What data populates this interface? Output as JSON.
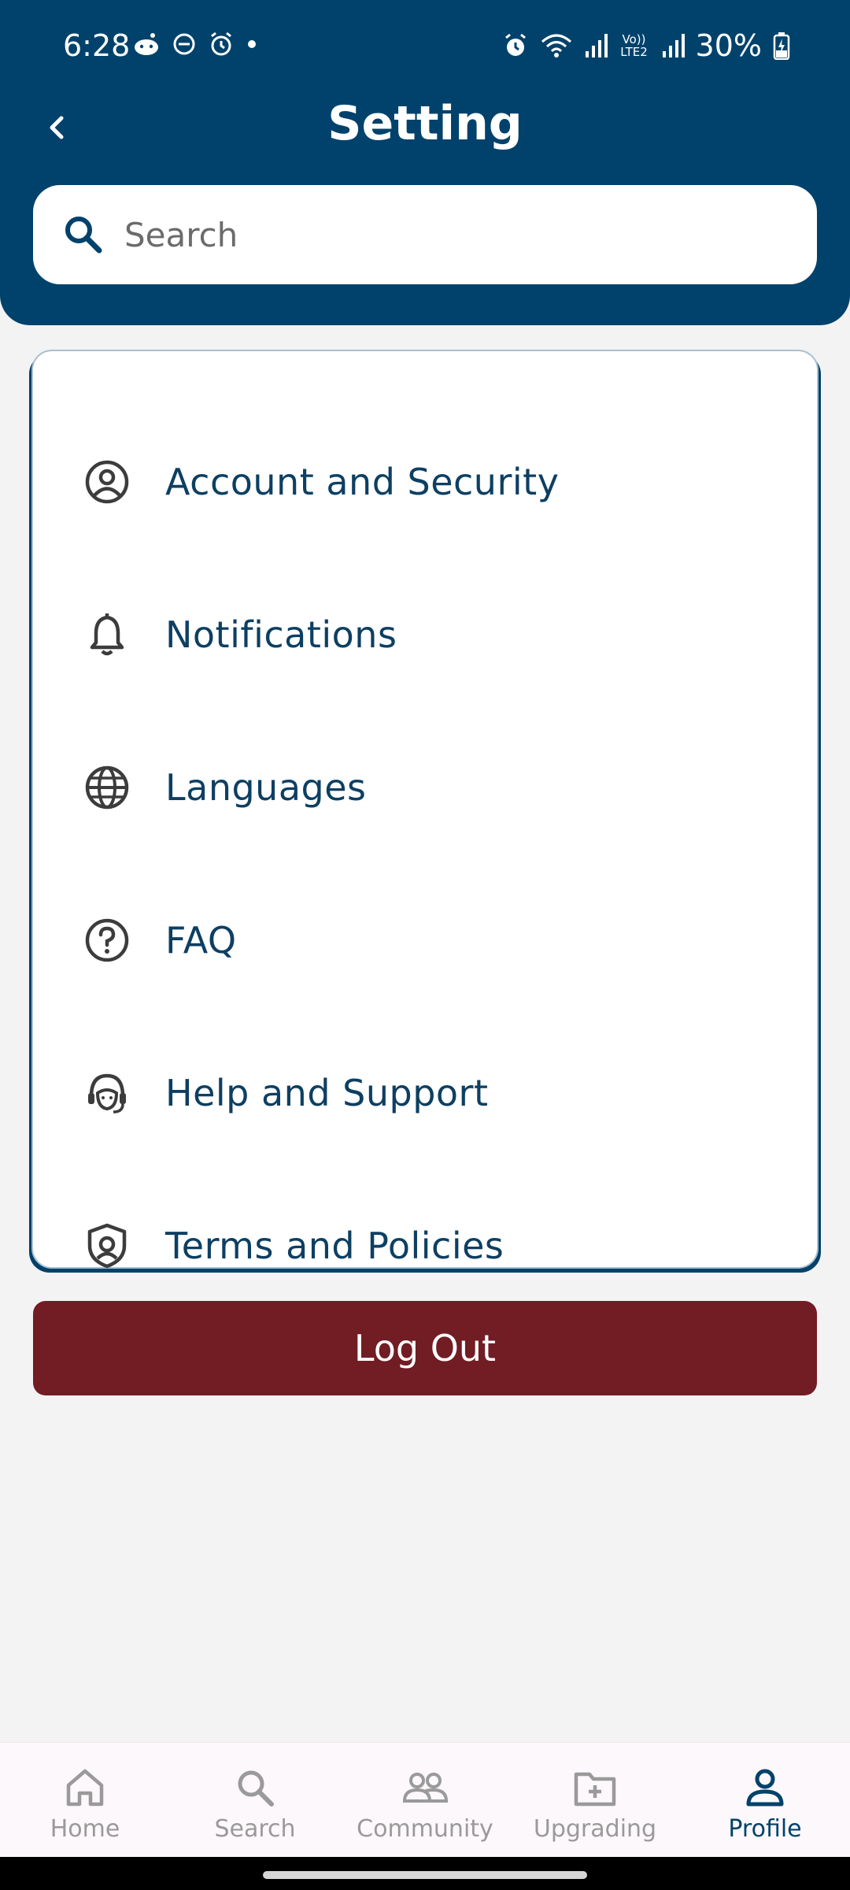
{
  "status_bar": {
    "time": "6:28",
    "battery": "30%",
    "network_label": "Vo)) LTE2"
  },
  "header": {
    "title": "Setting"
  },
  "search": {
    "placeholder": "Search"
  },
  "menu": {
    "items": [
      {
        "label": "Account and Security",
        "icon": "account-circle-icon"
      },
      {
        "label": "Notifications",
        "icon": "bell-icon"
      },
      {
        "label": "Languages",
        "icon": "globe-icon"
      },
      {
        "label": "FAQ",
        "icon": "question-circle-icon"
      },
      {
        "label": "Help and Support",
        "icon": "headset-icon"
      },
      {
        "label": "Terms and Policies",
        "icon": "shield-icon"
      }
    ]
  },
  "logout": {
    "label": "Log Out"
  },
  "bottom_nav": {
    "items": [
      {
        "label": "Home",
        "icon": "home-icon",
        "active": false
      },
      {
        "label": "Search",
        "icon": "search-icon",
        "active": false
      },
      {
        "label": "Community",
        "icon": "community-icon",
        "active": false
      },
      {
        "label": "Upgrading",
        "icon": "folder-plus-icon",
        "active": false
      },
      {
        "label": "Profile",
        "icon": "profile-icon",
        "active": true
      }
    ]
  },
  "colors": {
    "brand": "#00426b",
    "logout": "#721c24",
    "text_primary": "#0d3f62",
    "nav_inactive": "#9a9a9a"
  }
}
